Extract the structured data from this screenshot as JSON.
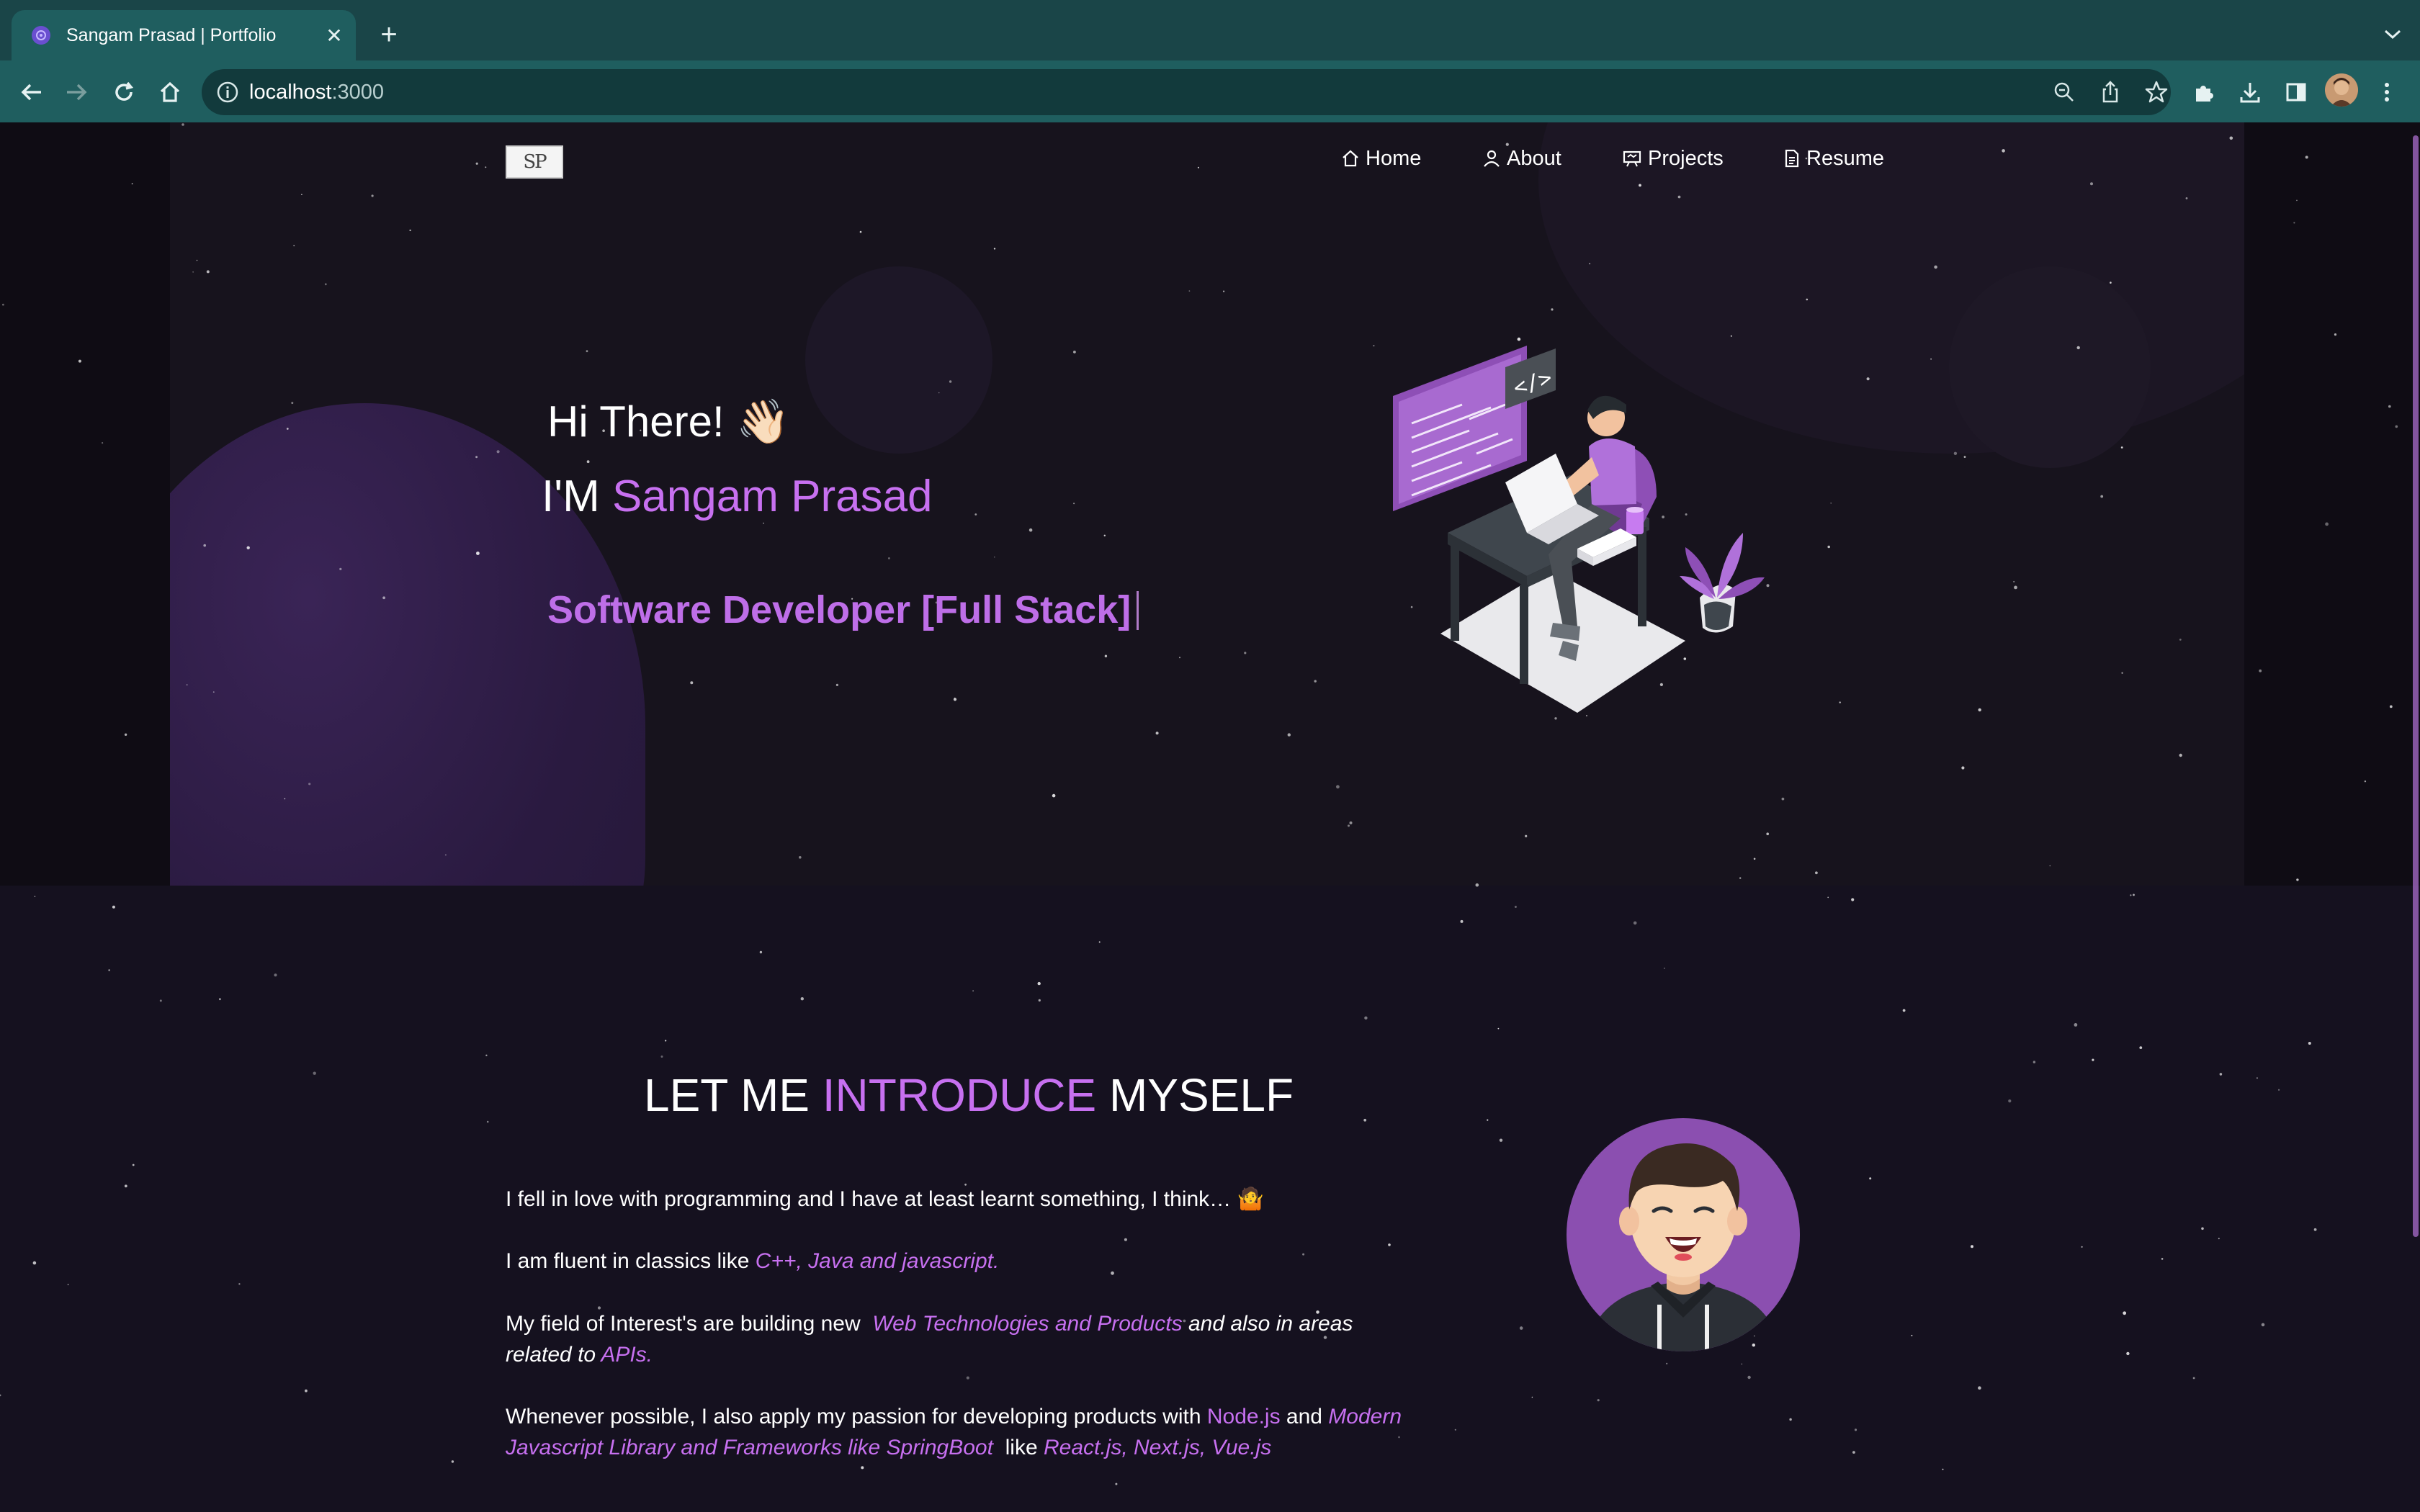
{
  "browser": {
    "tab_title": "Sangam Prasad | Portfolio",
    "url_host": "localhost",
    "url_port": ":3000"
  },
  "site": {
    "logo_text": "SP",
    "nav": [
      {
        "label": "Home",
        "icon": "home-icon"
      },
      {
        "label": "About",
        "icon": "user-icon"
      },
      {
        "label": "Projects",
        "icon": "projects-icon"
      },
      {
        "label": "Resume",
        "icon": "document-icon"
      }
    ]
  },
  "hero": {
    "greeting": "Hi There!",
    "wave": "👋🏻",
    "iam_prefix": "I'M ",
    "name": "Sangam Prasad",
    "role": "Software Developer [Full Stack]"
  },
  "intro": {
    "title_a": "LET ME ",
    "title_hl": "INTRODUCE",
    "title_b": " MYSELF",
    "p1": "I fell in love with programming and I have at least learnt something, I think… 🤷",
    "p2_a": "I am fluent in classics like ",
    "p2_hl": "C++, Java and javascript.",
    "p3_a": "My field of Interest's are building new  ",
    "p3_hl1": "Web Technologies and Products",
    "p3_b": " and also in areas",
    "p3_c": "related to ",
    "p3_hl2": "APIs.",
    "p4_a": "Whenever possible, I also apply my passion for developing products with ",
    "p4_hl1": "Node.js",
    "p4_b": " and ",
    "p4_hl2": "Modern",
    "p4_hl3": "Javascript Library and Frameworks like SpringBoot",
    "p4_c": "  like ",
    "p4_hl4": "React.js, Next.js, Vue.js"
  },
  "colors": {
    "accent": "#c770f0",
    "chrome": "#1f5e5f",
    "background": "#15111f"
  }
}
